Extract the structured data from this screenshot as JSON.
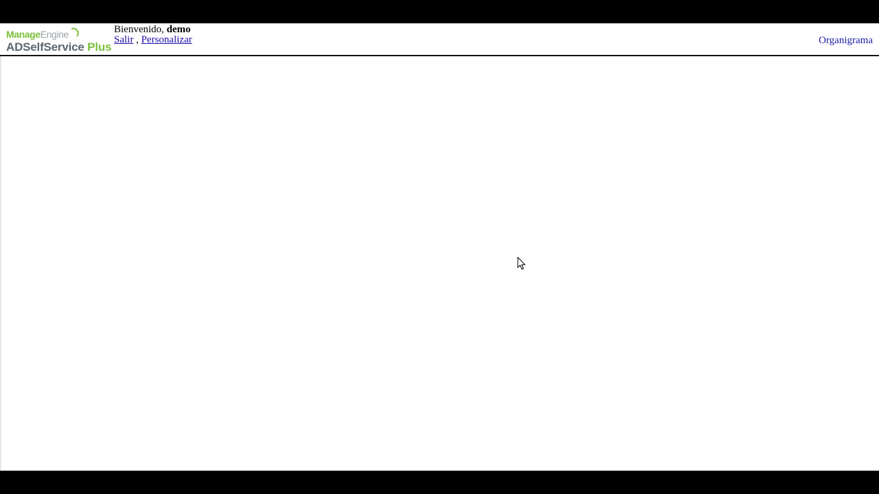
{
  "logo": {
    "brand_part1": "Manage",
    "brand_part2": "Engine",
    "product_part1": "ADSelfService",
    "product_part2": "Plus"
  },
  "header": {
    "welcome_prefix": "Bienvenido,",
    "username": "demo",
    "logout_link": "Salir",
    "separator": ",",
    "personalize_link": "Personalizar",
    "org_chart_link": "Organigrama"
  },
  "colors": {
    "brand_green": "#7cbf3a",
    "link_blue": "#1a0dab",
    "product_gray": "#5a6670"
  },
  "icons": {
    "cursor": "mouse-pointer-icon"
  }
}
